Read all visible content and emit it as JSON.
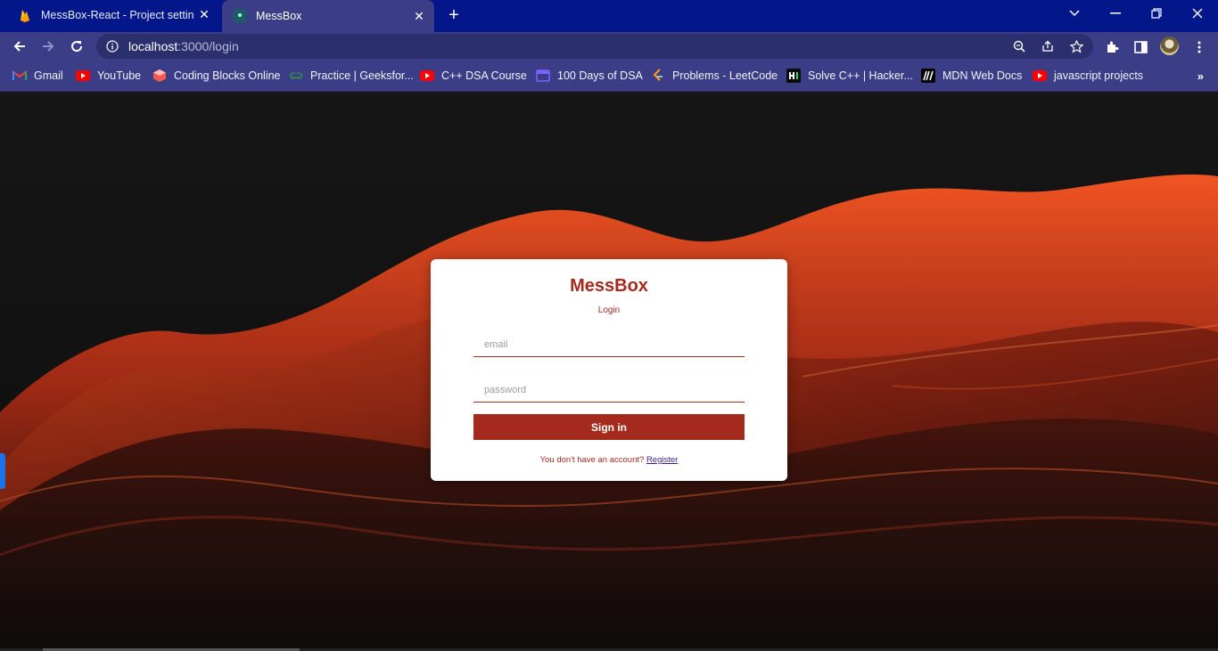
{
  "browser": {
    "tabs": [
      {
        "title": "MessBox-React - Project settings",
        "active": false,
        "favicon": "firebase-flame-icon"
      },
      {
        "title": "MessBox",
        "active": true,
        "favicon": "app-favicon"
      }
    ],
    "new_tab_symbol": "+",
    "close_symbol": "✕",
    "address": {
      "host": "localhost",
      "path": ":3000/login"
    },
    "bookmarks": [
      {
        "label": "Gmail",
        "icon": "gmail-icon",
        "color": "#ea4335"
      },
      {
        "label": "YouTube",
        "icon": "youtube-icon",
        "color": "#ff0000"
      },
      {
        "label": "Coding Blocks Online",
        "icon": "coding-blocks-icon",
        "color": "#f05a4f"
      },
      {
        "label": "Practice | Geeksfor...",
        "icon": "geeksforgeeks-icon",
        "color": "#2f8d46"
      },
      {
        "label": "C++ DSA Course",
        "icon": "youtube-icon",
        "color": "#ff0000"
      },
      {
        "label": "100 Days of DSA",
        "icon": "calendar-icon",
        "color": "#7b61ff"
      },
      {
        "label": "Problems - LeetCode",
        "icon": "leetcode-icon",
        "color": "#ffa116"
      },
      {
        "label": "Solve C++ | Hacker...",
        "icon": "hackerrank-icon",
        "color": "#00ea64"
      },
      {
        "label": "MDN Web Docs",
        "icon": "mdn-icon",
        "color": "#000000"
      },
      {
        "label": "javascript projects",
        "icon": "youtube-icon",
        "color": "#ff0000"
      }
    ],
    "overflow_symbol": "»"
  },
  "login": {
    "title": "MessBox",
    "subtitle": "Login",
    "email_placeholder": "email",
    "password_placeholder": "password",
    "submit_label": "Sign in",
    "register_prompt": "You don't have an account?",
    "register_link": "Register"
  },
  "colors": {
    "accent": "#a52a1e",
    "tabbar": "#03178a",
    "toolbar": "#3b3e86"
  }
}
